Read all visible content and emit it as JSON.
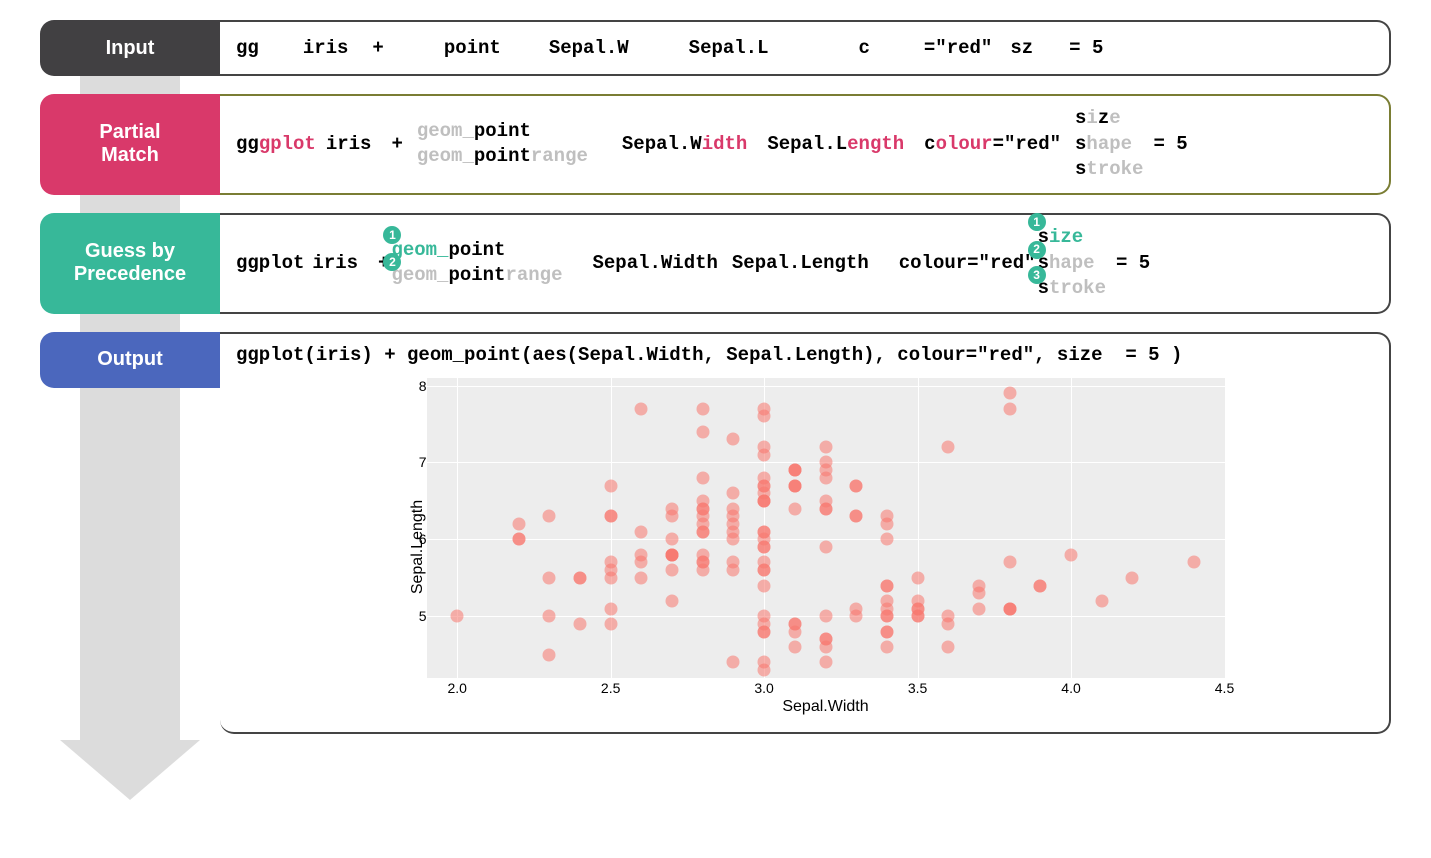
{
  "labels": {
    "input": "Input",
    "match": "Partial\nMatch",
    "guess": "Guess by\nPrecedence",
    "output": "Output"
  },
  "input_row": {
    "gg": "gg",
    "iris": "iris",
    "plus": "+",
    "point": "point",
    "sepalW": "Sepal.W",
    "sepalL": "Sepal.L",
    "c": "c",
    "eqred": "=\"red\"",
    "sz": "sz",
    "eq5": "= 5"
  },
  "match_row": {
    "gg": "gg",
    "gplot": "gplot",
    "iris": "iris",
    "plus": "+",
    "geom1a": "geom_",
    "geom1b": "point",
    "geom2a": "geom_",
    "geom2b": "point",
    "geom2c": "range",
    "sepalW1": "Sepal.W",
    "sepalW2": "idth",
    "sepalL1": "Sepal.L",
    "sepalL2": "ength",
    "c": "c",
    "olour": "olour",
    "eqred": "=\"red\"",
    "s1a": "s",
    "s1b": "i",
    "s1c": "z",
    "s1d": "e",
    "s2a": "s",
    "s2b": "hape",
    "s3a": "s",
    "s3b": "troke",
    "eq5": "= 5"
  },
  "guess_row": {
    "ggplot": "ggplot",
    "iris": "iris",
    "plus": "+",
    "b1": "1",
    "geom1a": "geom_",
    "geom1b": "point",
    "b2": "2",
    "geom2a": "geom_",
    "geom2b": "point",
    "geom2c": "range",
    "sepalW": "Sepal.Width",
    "sepalL": "Sepal.Length",
    "coloureq": "colour=\"red\"",
    "sb1": "1",
    "s1a": "s",
    "s1b": "iz",
    "s1c": "e",
    "sb2": "2",
    "s2a": "s",
    "s2b": "hape",
    "sb3": "3",
    "s3a": "s",
    "s3b": "troke",
    "eq5": "= 5"
  },
  "output_code": "ggplot(iris) + geom_point(aes(Sepal.Width, Sepal.Length), colour=\"red\", size  = 5 )",
  "chart_data": {
    "type": "scatter",
    "xlabel": "Sepal.Width",
    "ylabel": "Sepal.Length",
    "xlim": [
      1.9,
      4.5
    ],
    "ylim": [
      4.2,
      8.1
    ],
    "x_ticks": [
      "2.0",
      "2.5",
      "3.0",
      "3.5",
      "4.0",
      "4.5"
    ],
    "y_ticks": [
      "5",
      "6",
      "7",
      "8"
    ],
    "color": "#f8766d",
    "size": 5,
    "points": [
      [
        5.1,
        3.5
      ],
      [
        4.9,
        3.0
      ],
      [
        4.7,
        3.2
      ],
      [
        4.6,
        3.1
      ],
      [
        5.0,
        3.6
      ],
      [
        5.4,
        3.9
      ],
      [
        4.6,
        3.4
      ],
      [
        5.0,
        3.4
      ],
      [
        4.4,
        2.9
      ],
      [
        4.9,
        3.1
      ],
      [
        5.4,
        3.7
      ],
      [
        4.8,
        3.4
      ],
      [
        4.8,
        3.0
      ],
      [
        4.3,
        3.0
      ],
      [
        5.8,
        4.0
      ],
      [
        5.7,
        4.4
      ],
      [
        5.4,
        3.9
      ],
      [
        5.1,
        3.5
      ],
      [
        5.7,
        3.8
      ],
      [
        5.1,
        3.8
      ],
      [
        5.4,
        3.4
      ],
      [
        5.1,
        3.7
      ],
      [
        4.6,
        3.6
      ],
      [
        5.1,
        3.3
      ],
      [
        4.8,
        3.4
      ],
      [
        5.0,
        3.0
      ],
      [
        5.0,
        3.4
      ],
      [
        5.2,
        3.5
      ],
      [
        5.2,
        3.4
      ],
      [
        4.7,
        3.2
      ],
      [
        4.8,
        3.1
      ],
      [
        5.4,
        3.4
      ],
      [
        5.2,
        4.1
      ],
      [
        5.5,
        4.2
      ],
      [
        4.9,
        3.1
      ],
      [
        5.0,
        3.2
      ],
      [
        5.5,
        3.5
      ],
      [
        4.9,
        3.6
      ],
      [
        4.4,
        3.0
      ],
      [
        5.1,
        3.4
      ],
      [
        5.0,
        3.5
      ],
      [
        4.5,
        2.3
      ],
      [
        4.4,
        3.2
      ],
      [
        5.0,
        3.5
      ],
      [
        5.1,
        3.8
      ],
      [
        4.8,
        3.0
      ],
      [
        5.1,
        3.8
      ],
      [
        4.6,
        3.2
      ],
      [
        5.3,
        3.7
      ],
      [
        5.0,
        3.3
      ],
      [
        7.0,
        3.2
      ],
      [
        6.4,
        3.2
      ],
      [
        6.9,
        3.1
      ],
      [
        5.5,
        2.3
      ],
      [
        6.5,
        2.8
      ],
      [
        5.7,
        2.8
      ],
      [
        6.3,
        3.3
      ],
      [
        4.9,
        2.4
      ],
      [
        6.6,
        2.9
      ],
      [
        5.2,
        2.7
      ],
      [
        5.0,
        2.0
      ],
      [
        5.9,
        3.0
      ],
      [
        6.0,
        2.2
      ],
      [
        6.1,
        2.9
      ],
      [
        5.6,
        2.9
      ],
      [
        6.7,
        3.1
      ],
      [
        5.6,
        3.0
      ],
      [
        5.8,
        2.7
      ],
      [
        6.2,
        2.2
      ],
      [
        5.6,
        2.5
      ],
      [
        5.9,
        3.2
      ],
      [
        6.1,
        2.8
      ],
      [
        6.3,
        2.5
      ],
      [
        6.1,
        2.8
      ],
      [
        6.4,
        2.9
      ],
      [
        6.6,
        3.0
      ],
      [
        6.8,
        2.8
      ],
      [
        6.7,
        3.0
      ],
      [
        6.0,
        2.9
      ],
      [
        5.7,
        2.6
      ],
      [
        5.5,
        2.4
      ],
      [
        5.5,
        2.4
      ],
      [
        5.8,
        2.7
      ],
      [
        6.0,
        2.7
      ],
      [
        5.4,
        3.0
      ],
      [
        6.0,
        3.4
      ],
      [
        6.7,
        3.1
      ],
      [
        6.3,
        2.3
      ],
      [
        5.6,
        3.0
      ],
      [
        5.5,
        2.5
      ],
      [
        5.5,
        2.6
      ],
      [
        6.1,
        3.0
      ],
      [
        5.8,
        2.6
      ],
      [
        5.0,
        2.3
      ],
      [
        5.6,
        2.7
      ],
      [
        5.7,
        3.0
      ],
      [
        5.7,
        2.9
      ],
      [
        6.2,
        2.9
      ],
      [
        5.1,
        2.5
      ],
      [
        5.7,
        2.8
      ],
      [
        6.3,
        3.3
      ],
      [
        5.8,
        2.7
      ],
      [
        7.1,
        3.0
      ],
      [
        6.3,
        2.9
      ],
      [
        6.5,
        3.0
      ],
      [
        7.6,
        3.0
      ],
      [
        4.9,
        2.5
      ],
      [
        7.3,
        2.9
      ],
      [
        6.7,
        2.5
      ],
      [
        7.2,
        3.6
      ],
      [
        6.5,
        3.2
      ],
      [
        6.4,
        2.7
      ],
      [
        6.8,
        3.0
      ],
      [
        5.7,
        2.5
      ],
      [
        5.8,
        2.8
      ],
      [
        6.4,
        3.2
      ],
      [
        6.5,
        3.0
      ],
      [
        7.7,
        3.8
      ],
      [
        7.7,
        2.6
      ],
      [
        6.0,
        2.2
      ],
      [
        6.9,
        3.2
      ],
      [
        5.6,
        2.8
      ],
      [
        7.7,
        2.8
      ],
      [
        6.3,
        2.7
      ],
      [
        6.7,
        3.3
      ],
      [
        7.2,
        3.2
      ],
      [
        6.2,
        2.8
      ],
      [
        6.1,
        3.0
      ],
      [
        6.4,
        2.8
      ],
      [
        7.2,
        3.0
      ],
      [
        7.4,
        2.8
      ],
      [
        7.9,
        3.8
      ],
      [
        6.4,
        2.8
      ],
      [
        6.3,
        2.8
      ],
      [
        6.1,
        2.6
      ],
      [
        7.7,
        3.0
      ],
      [
        6.3,
        3.4
      ],
      [
        6.4,
        3.1
      ],
      [
        6.0,
        3.0
      ],
      [
        6.9,
        3.1
      ],
      [
        6.7,
        3.1
      ],
      [
        6.9,
        3.1
      ],
      [
        5.8,
        2.7
      ],
      [
        6.8,
        3.2
      ],
      [
        6.7,
        3.3
      ],
      [
        6.7,
        3.0
      ],
      [
        6.3,
        2.5
      ],
      [
        6.5,
        3.0
      ],
      [
        6.2,
        3.4
      ],
      [
        5.9,
        3.0
      ]
    ]
  }
}
